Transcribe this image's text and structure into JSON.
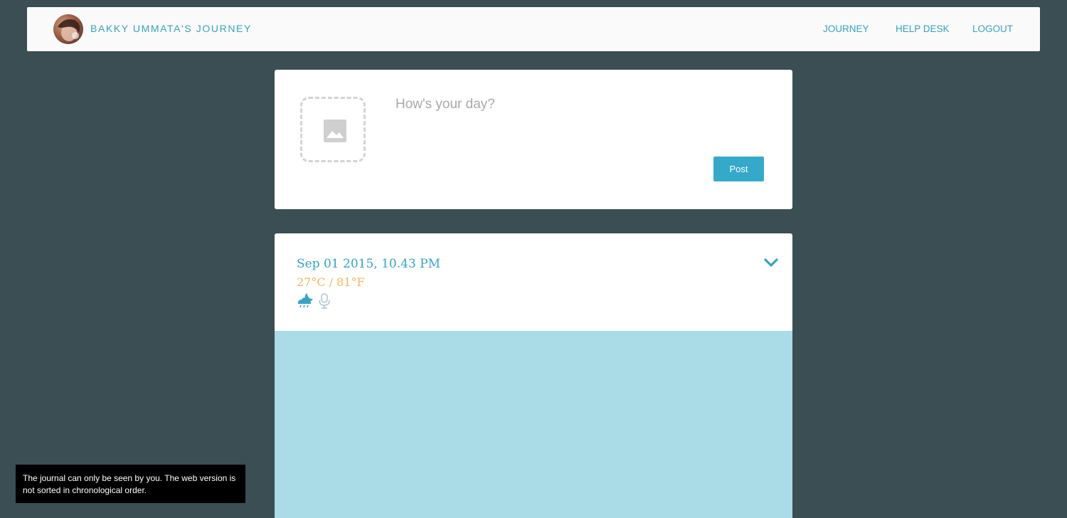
{
  "header": {
    "title": "BAKKY UMMATA'S JOURNEY",
    "avatar_icon": "user-avatar",
    "nav": {
      "journey": "JOURNEY",
      "help_desk": "HELP DESK",
      "logout": "LOGOUT"
    }
  },
  "composer": {
    "placeholder": "How's your day?",
    "image_icon": "image-placeholder-icon",
    "post_label": "Post"
  },
  "entry": {
    "date": "Sep 01 2015, 10.43 PM",
    "temperature": "27°C / 81°F",
    "weather_icon": "night-rain-icon",
    "audio_icon": "microphone-icon",
    "expand_icon": "chevron-down-icon"
  },
  "notice": {
    "text": "The journal can only be seen by you. The web version is not sorted in chronological order."
  },
  "colors": {
    "background": "#3a4e53",
    "accent": "#35a3c1",
    "temperature": "#f3b85c",
    "media_placeholder": "#a9dce6",
    "notice_bg": "#000000"
  }
}
